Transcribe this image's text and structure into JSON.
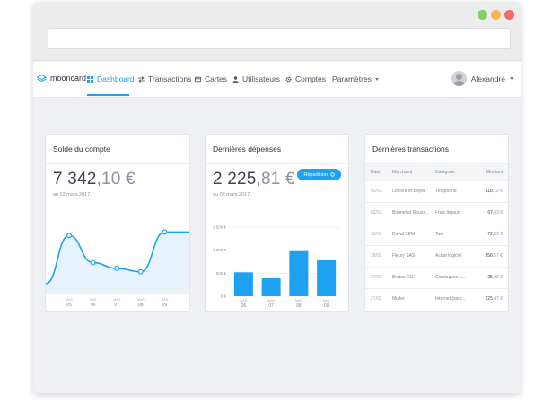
{
  "colors": {
    "accent": "#1da1f2",
    "window_close": "#f16b6b",
    "window_min": "#f5b54a",
    "window_max": "#7ed06b"
  },
  "brand": {
    "name": "mooncard",
    "icon": "mooncard-logo-icon"
  },
  "nav": {
    "items": [
      {
        "label": "Dashboard",
        "icon": "grid-icon"
      },
      {
        "label": "Transactions",
        "icon": "arrows-icon"
      },
      {
        "label": "Cartes",
        "icon": "card-icon"
      },
      {
        "label": "Utilisateurs",
        "icon": "user-icon"
      },
      {
        "label": "Comptes",
        "icon": "gear-icon"
      },
      {
        "label": "Paramètres",
        "icon": "chevron-down-icon"
      }
    ],
    "active": "Dashboard",
    "user_name": "Alexandre"
  },
  "balance": {
    "title": "Solde du compte",
    "amount_int": "7 342",
    "amount_dec": ",10 €",
    "date": "au 02 mars 2017"
  },
  "expenses": {
    "title": "Dernières dépenses",
    "amount_int": "2 225",
    "amount_dec": ",81 €",
    "date": "au 02 mars 2017",
    "button_label": "Répartition"
  },
  "transactions": {
    "title": "Dernières transactions",
    "headers": {
      "date": "Date",
      "merchant": "Marchand",
      "category": "Catégorie",
      "amount": "Montant"
    },
    "rows": [
      {
        "date": "02/03",
        "merchant": "Lefevre et Boyer",
        "category": "Téléphone",
        "amount_int": "118",
        "amount_dec": ",12 €"
      },
      {
        "date": "02/03",
        "merchant": "Bonnet et Rouss...",
        "category": "Frais légaux",
        "amount_int": "67",
        "amount_dec": ",43 €"
      },
      {
        "date": "28/02",
        "merchant": "Duval SEM",
        "category": "Taxi",
        "amount_int": "72",
        "amount_dec": ",03 €"
      },
      {
        "date": "28/02",
        "merchant": "Fleury SAS",
        "category": "Achat logiciel",
        "amount_int": "356",
        "amount_dec": ",57 €"
      },
      {
        "date": "27/02",
        "merchant": "Breton GIE",
        "category": "Catalogues e...",
        "amount_int": "25",
        "amount_dec": ",99 €"
      },
      {
        "date": "27/02",
        "merchant": "Muller",
        "category": "Internet (serv...",
        "amount_int": "225",
        "amount_dec": ",47 €"
      }
    ]
  },
  "chart_data": [
    {
      "type": "area",
      "title": "Solde du compte",
      "categories": [
        "05",
        "06",
        "07",
        "08",
        "09"
      ],
      "tick_top_label": "MAR",
      "values": [
        7600,
        6400,
        6150,
        6000,
        7750
      ],
      "grid": false
    },
    {
      "type": "bar",
      "title": "Dernières dépenses",
      "categories": [
        "06",
        "07",
        "08",
        "09"
      ],
      "tick_top_label": "MAR",
      "values": [
        520,
        390,
        980,
        780
      ],
      "y_ticks": [
        "0 €",
        "500 €",
        "1 000 €",
        "1 500 €"
      ],
      "ylim": [
        0,
        1500
      ],
      "grid": true
    }
  ]
}
